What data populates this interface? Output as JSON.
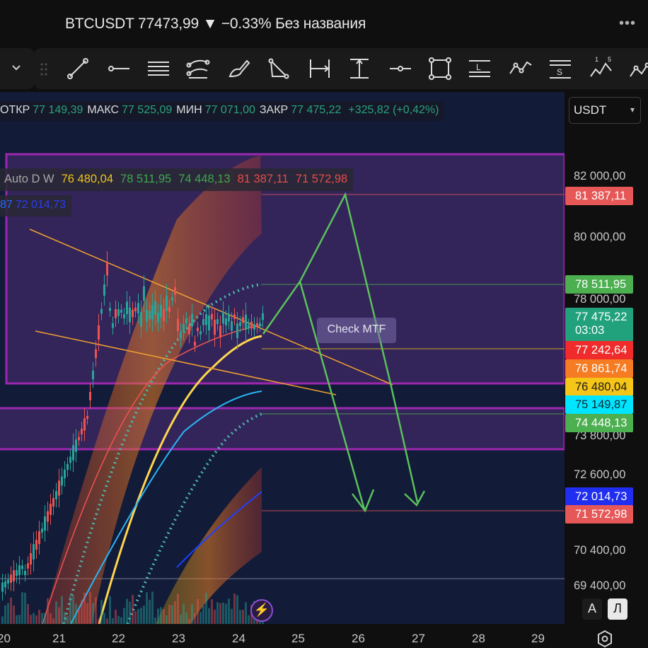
{
  "title": {
    "text": "BTCUSDT 77473,99 ▼ −0.33% Без названия",
    "more": "•••"
  },
  "toolbar": {
    "tools": [
      {
        "name": "trend-line-tool"
      },
      {
        "name": "horizontal-ray-tool"
      },
      {
        "name": "pitchfork-lines-tool"
      },
      {
        "name": "parallel-channel-tool"
      },
      {
        "name": "brush-tool"
      },
      {
        "name": "triangle-pattern-tool"
      },
      {
        "name": "date-range-tool"
      },
      {
        "name": "price-range-tool"
      },
      {
        "name": "horizontal-line-tool"
      },
      {
        "name": "rectangle-tool"
      },
      {
        "name": "long-position-tool",
        "label": "L"
      },
      {
        "name": "path-tool"
      },
      {
        "name": "short-position-tool",
        "label": "S"
      },
      {
        "name": "xabcd-pattern-tool",
        "label": "1 5"
      },
      {
        "name": "elliott-wave-tool"
      }
    ]
  },
  "ohlc": {
    "open_label": "ОТКР",
    "open": "77 149,39",
    "high_label": "МАКС",
    "high": "77 525,09",
    "low_label": "МИН",
    "low": "77 071,00",
    "close_label": "ЗАКР",
    "close": "77 475,22",
    "change": "+325,82 (+0,42%)"
  },
  "legend": {
    "name": "Auto D W",
    "values": [
      {
        "text": "76 480,04",
        "color": "#f0c419"
      },
      {
        "text": "78 511,95",
        "color": "#3ea84e"
      },
      {
        "text": "74 448,13",
        "color": "#3ea84e"
      },
      {
        "text": "81 387,11",
        "color": "#e84b4b"
      },
      {
        "text": "71 572,98",
        "color": "#e84b4b"
      }
    ],
    "row2_prefix": "87",
    "row2_value": "72 014,73"
  },
  "annotation": "Check MTF",
  "scale": {
    "currency": "USDT",
    "labels": [
      "82 000,00",
      "80 000,00",
      "78 000,00",
      "73 800,00",
      "72 600,00",
      "70 400,00",
      "69 400,00"
    ],
    "tags": [
      {
        "text": "81 387,11",
        "bg": "#e65858",
        "fg": "#ffffff"
      },
      {
        "text": "78 511,95",
        "bg": "#4caf50",
        "fg": "#ffffff"
      },
      {
        "text": "77 475,22",
        "bg": "#22a27c",
        "fg": "#ffffff"
      },
      {
        "text": "03:03",
        "bg": "#22a27c",
        "fg": "#ffffff"
      },
      {
        "text": "77 242,64",
        "bg": "#ef2b2b",
        "fg": "#ffffff"
      },
      {
        "text": "76 861,74",
        "bg": "#f57c22",
        "fg": "#ffffff"
      },
      {
        "text": "76 480,04",
        "bg": "#f5c518",
        "fg": "#1a1a1a"
      },
      {
        "text": "75 149,87",
        "bg": "#00e5ff",
        "fg": "#0a2a33"
      },
      {
        "text": "74 448,13",
        "bg": "#4caf50",
        "fg": "#ffffff"
      },
      {
        "text": "72 014,73",
        "bg": "#1f2ef0",
        "fg": "#ffffff"
      },
      {
        "text": "71 572,98",
        "bg": "#e65858",
        "fg": "#ffffff"
      }
    ],
    "auto_btn": "А",
    "log_btn": "Л"
  },
  "time_axis": [
    "20",
    "21",
    "22",
    "23",
    "24",
    "25",
    "26",
    "27",
    "28",
    "29"
  ],
  "colors": {
    "chart_bg": "#121b38",
    "up": "#26a69a",
    "down": "#ef5350",
    "zone": "#9c27b0"
  }
}
